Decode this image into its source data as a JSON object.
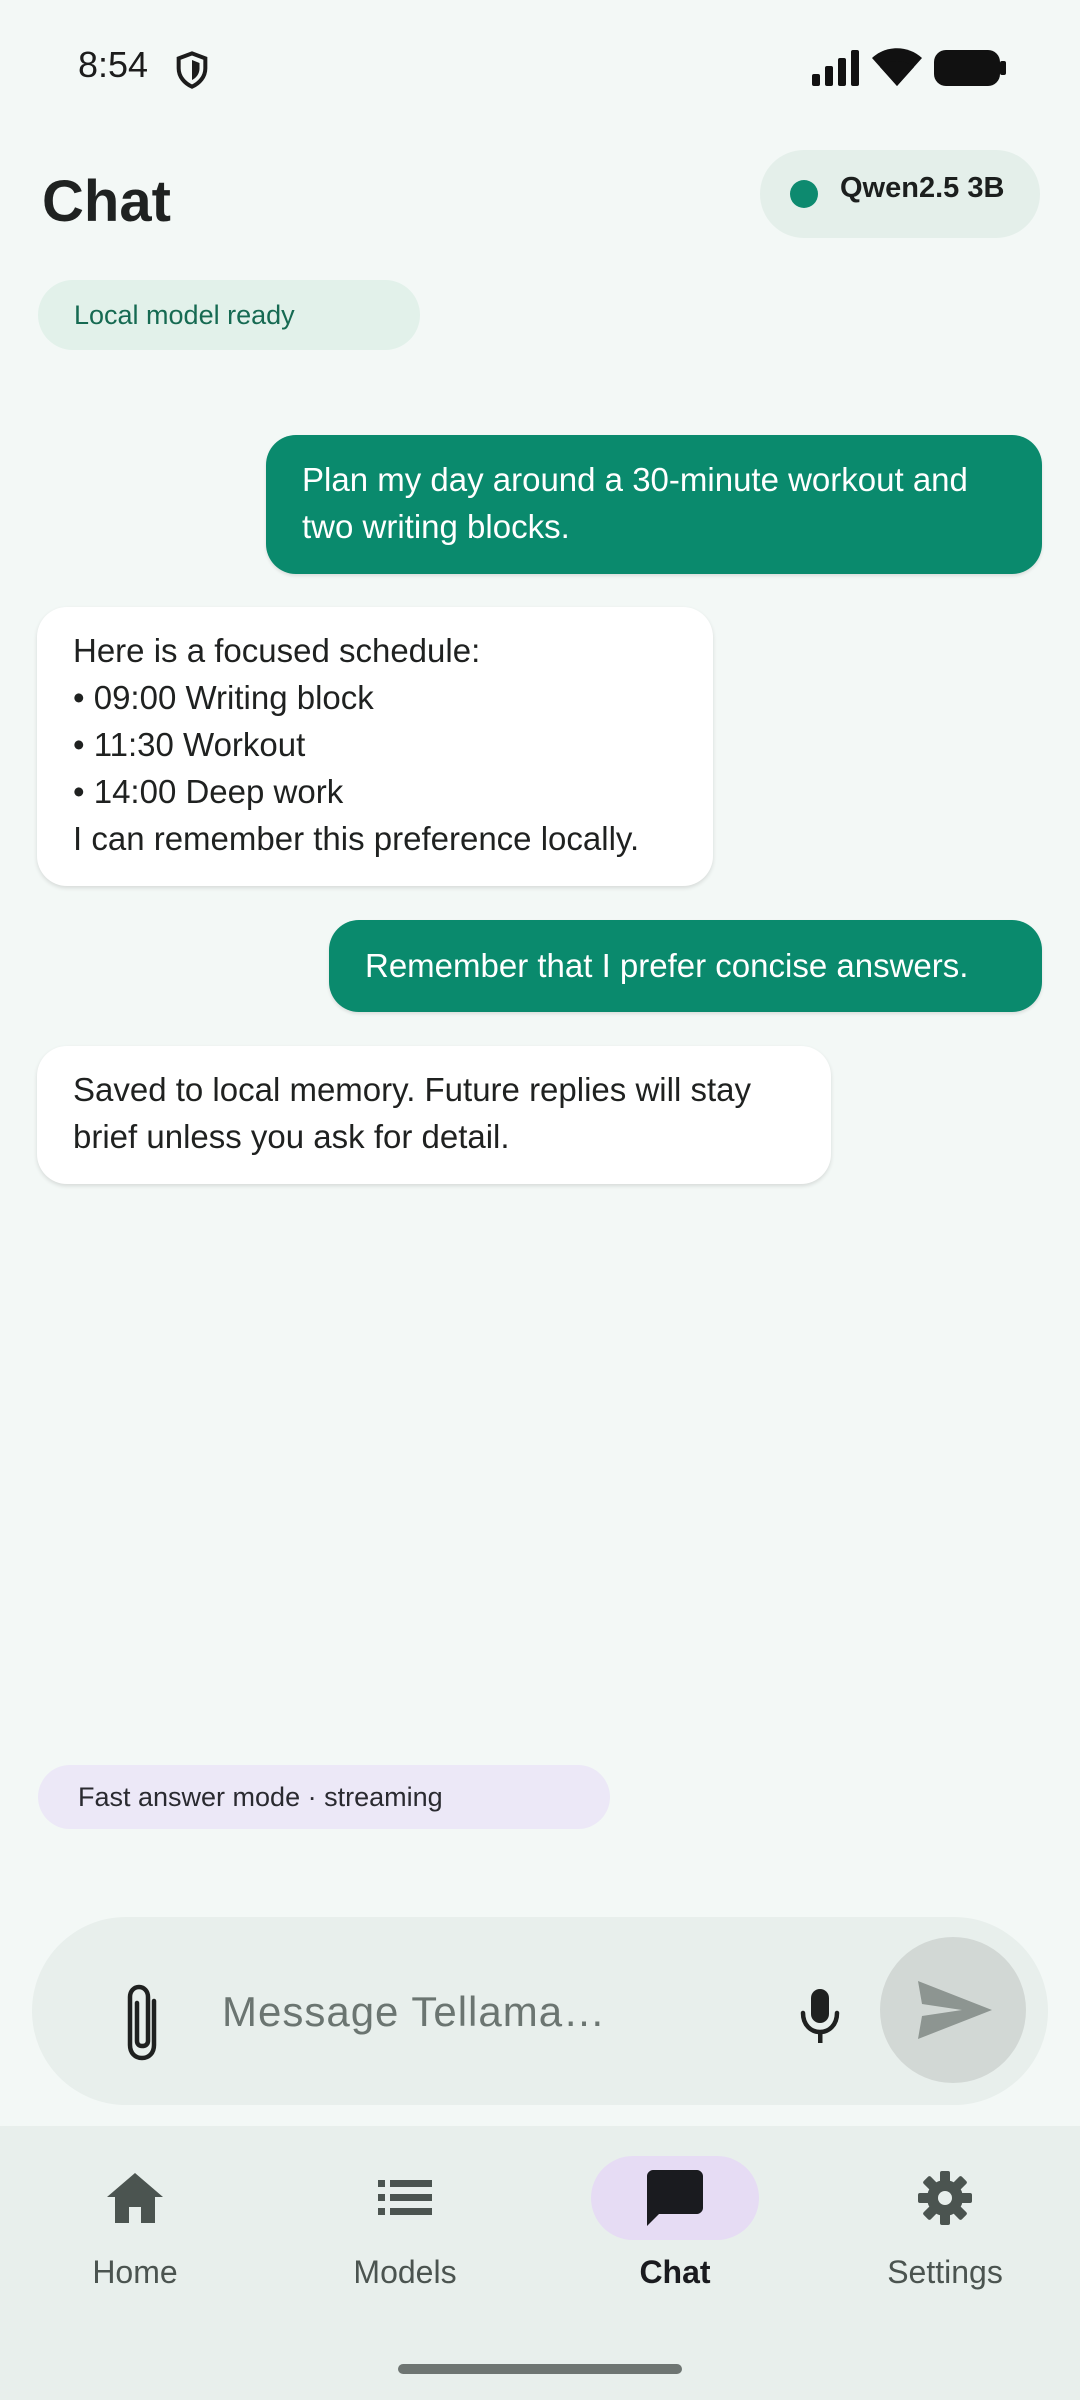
{
  "status_bar": {
    "time": "8:54",
    "icons": [
      "shield-icon",
      "signal-icon",
      "wifi-icon",
      "battery-icon"
    ]
  },
  "header": {
    "title": "Chat",
    "model_name": "Qwen2.5 3B",
    "model_status_color": "#0d8a6f",
    "status_chip": "Local model ready"
  },
  "messages": [
    {
      "role": "user",
      "lines": [
        "Plan my day around a 30-minute workout and",
        "two writing blocks."
      ]
    },
    {
      "role": "assistant",
      "lines": [
        "Here is a focused schedule:",
        "• 09:00 Writing block",
        "• 11:30 Workout",
        "• 14:00 Deep work",
        "I can remember this preference locally."
      ]
    },
    {
      "role": "user",
      "lines": [
        "Remember that I prefer concise answers."
      ]
    },
    {
      "role": "assistant",
      "lines": [
        "Saved to local memory. Future replies will stay",
        "brief unless you ask for detail."
      ]
    }
  ],
  "mode_chip": "Fast answer mode · streaming",
  "composer": {
    "placeholder": "Message Tellama…",
    "value": "",
    "icons": [
      "paperclip-icon",
      "mic-icon",
      "send-icon"
    ]
  },
  "nav": {
    "items": [
      {
        "label": "Home",
        "icon": "home-icon",
        "active": false
      },
      {
        "label": "Models",
        "icon": "list-icon",
        "active": false
      },
      {
        "label": "Chat",
        "icon": "chat-icon",
        "active": true
      },
      {
        "label": "Settings",
        "icon": "gear-icon",
        "active": false
      }
    ]
  },
  "colors": {
    "accent": "#0a8a6d",
    "background": "#f3f8f6",
    "nav_active_pill": "#e6dcf4"
  }
}
